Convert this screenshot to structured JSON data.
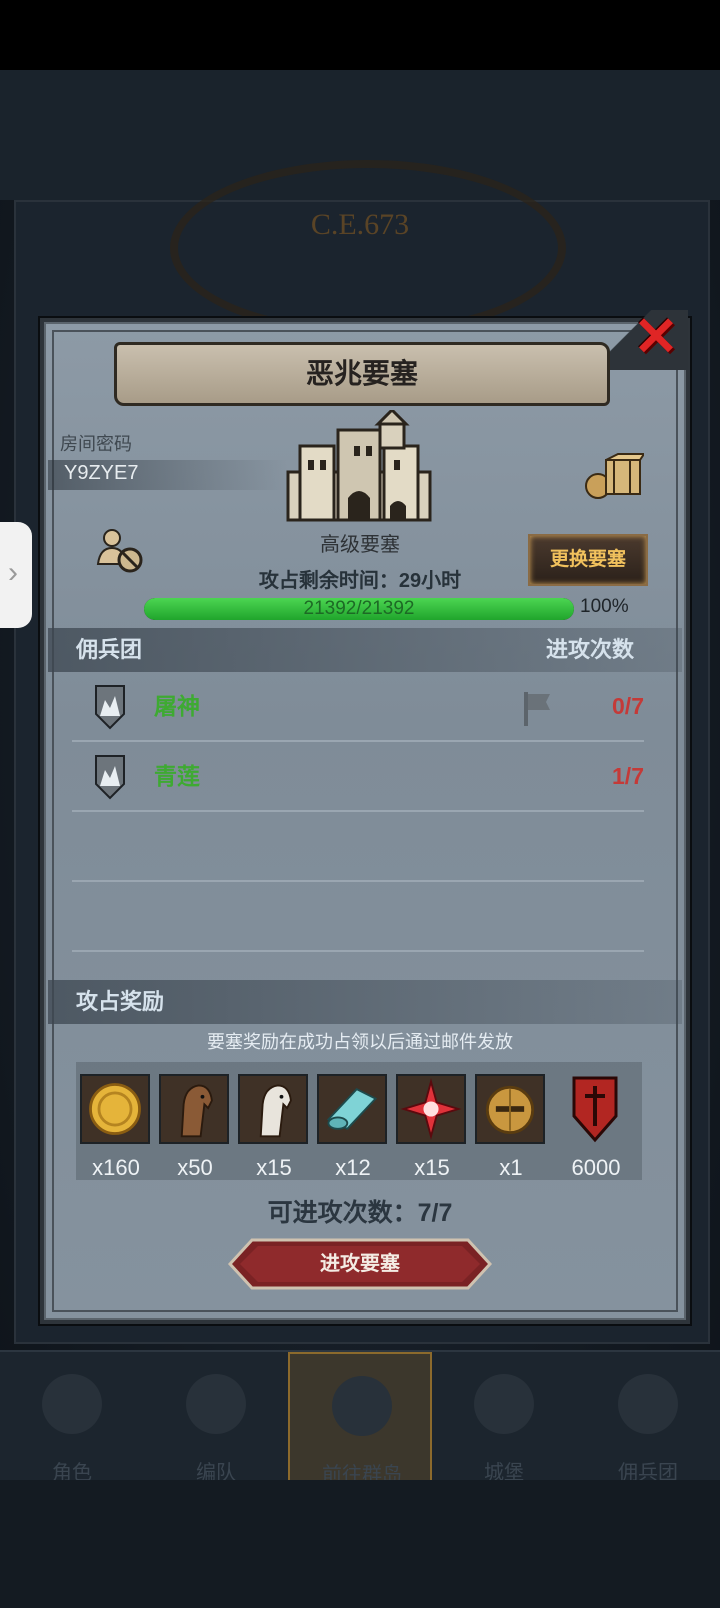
{
  "background": {
    "era_label": "C.E.673"
  },
  "dialog": {
    "title": "恶兆要塞",
    "room_password_label": "房间密码",
    "room_password": "Y9ZYE7",
    "fortress_level": "高级要塞",
    "change_button": "更换要塞",
    "time_remaining": "攻占剩余时间：29小时",
    "hp_text": "21392/21392",
    "hp_fraction": 1.0,
    "hp_percent": "100%",
    "mercenary_header": "佣兵团",
    "attacks_header": "进攻次数",
    "guilds": [
      {
        "name": "屠神",
        "attacks": "0/7"
      },
      {
        "name": "青莲",
        "attacks": "1/7"
      }
    ],
    "rewards_header": "攻占奖励",
    "rewards_note": "要塞奖励在成功占领以后通过邮件发放",
    "rewards": [
      {
        "icon": "gold-coin-icon",
        "qty": "x160"
      },
      {
        "icon": "brown-horse-icon",
        "qty": "x50"
      },
      {
        "icon": "white-horse-icon",
        "qty": "x15"
      },
      {
        "icon": "cloth-scroll-icon",
        "qty": "x12"
      },
      {
        "icon": "red-star-icon",
        "qty": "x15"
      },
      {
        "icon": "knight-helmet-icon",
        "qty": "x1"
      },
      {
        "icon": "sword-shield-icon",
        "qty": "6000"
      }
    ],
    "attacks_available": "可进攻次数：7/7",
    "attack_button": "进攻要塞"
  },
  "bottom_nav": [
    {
      "label": "角色",
      "icon": "character-icon"
    },
    {
      "label": "编队",
      "icon": "formation-icon"
    },
    {
      "label": "前往群岛",
      "icon": "islands-icon",
      "active": true
    },
    {
      "label": "城堡",
      "icon": "castle-icon"
    },
    {
      "label": "佣兵团",
      "icon": "mercenary-icon"
    }
  ],
  "colors": {
    "guild_name": "#3eaa32",
    "attack_count": "#c43a38",
    "hp_fill": "#2fbf3b",
    "close": "#e02525",
    "change_button_text": "#f1c15d"
  }
}
